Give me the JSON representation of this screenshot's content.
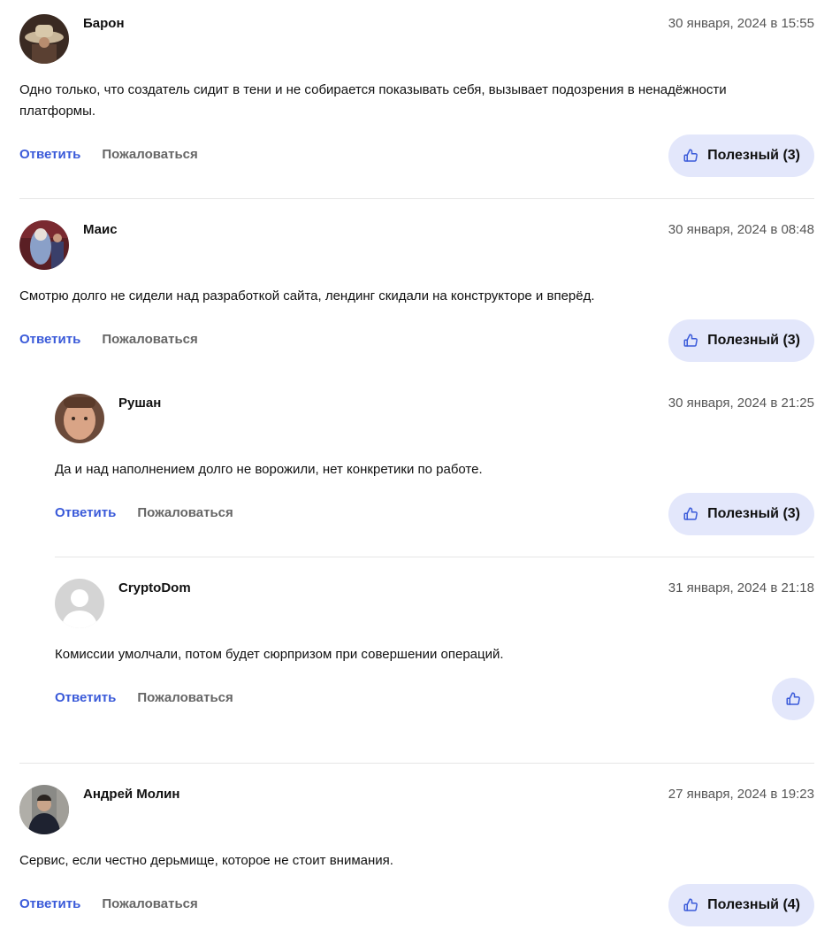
{
  "colors": {
    "accent": "#3a5ad9",
    "useful_bg": "#e3e7fb",
    "date": "#555555",
    "report": "#666666"
  },
  "actions": {
    "reply_label": "Ответить",
    "report_label": "Пожаловаться"
  },
  "comments": [
    {
      "author": "Барон",
      "date": "30 января, 2024 в 15:55",
      "text_line1": "Одно только, что создатель сидит в тени и не собирается показывать себя, вызывает подозрения в ненадёжности",
      "text_line2": "платформы.",
      "useful_label": "Полезный (3)"
    },
    {
      "author": "Маис",
      "date": "30 января, 2024 в 08:48",
      "text": "Смотрю долго не сидели над разработкой сайта, лендинг скидали на конструкторе и вперёд.",
      "useful_label": "Полезный (3)"
    },
    {
      "author": "Рушан",
      "date": "30 января, 2024 в 21:25",
      "text": "Да и над наполнением долго не ворожили, нет конкретики по работе.",
      "useful_label": "Полезный (3)"
    },
    {
      "author": "CryptoDom",
      "date": "31 января, 2024 в 21:18",
      "text": "Комиссии умолчали, потом будет сюрпризом при совершении операций."
    },
    {
      "author": "Андрей Молин",
      "date": "27 января, 2024 в 19:23",
      "text": "Сервис, если честно дерьмище, которое не стоит внимания.",
      "useful_label": "Полезный (4)"
    }
  ]
}
